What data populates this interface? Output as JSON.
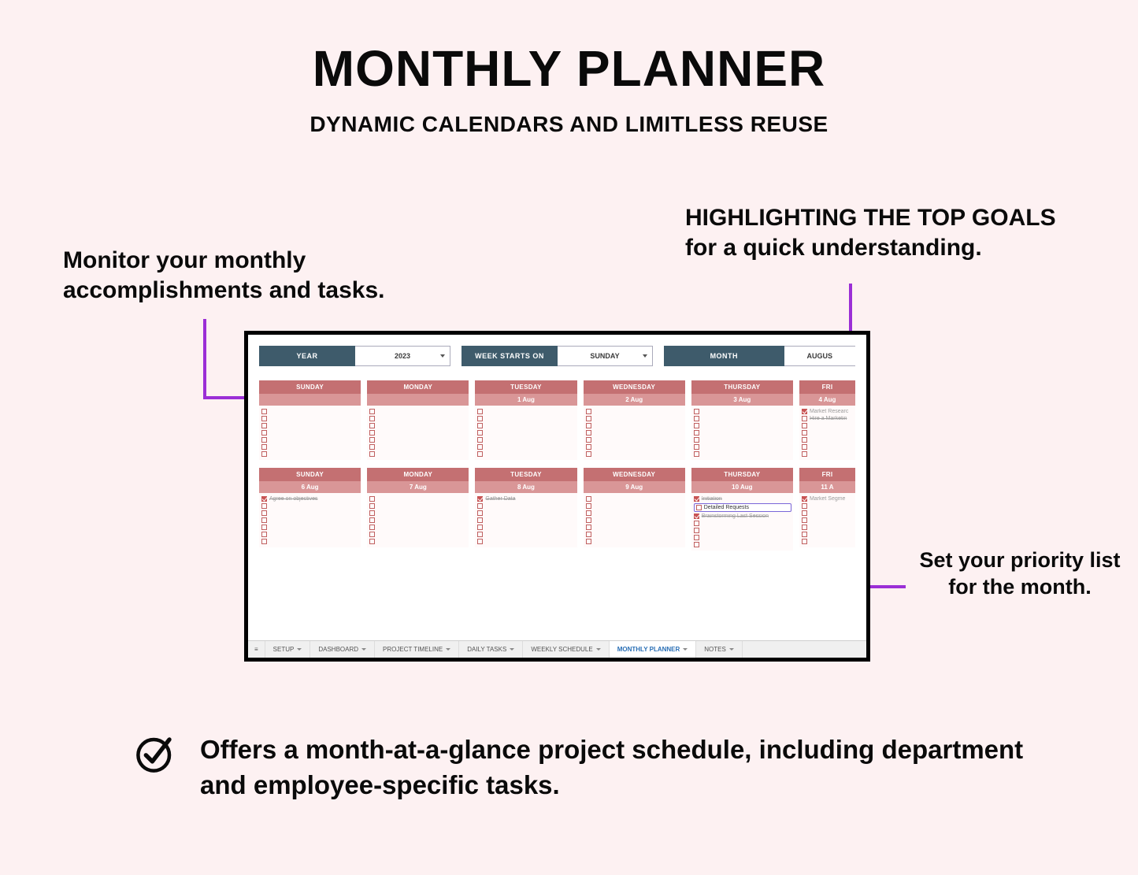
{
  "title": "MONTHLY PLANNER",
  "subtitle": "DYNAMIC CALENDARS AND LIMITLESS REUSE",
  "callouts": {
    "left_top": "Monitor your monthly accomplishments and tasks.",
    "right_top_line1": "HIGHLIGHTING THE TOP GOALS",
    "right_top_line2": "for a quick understanding.",
    "right_mid_line1": "Set your priority list",
    "right_mid_line2": "for the month."
  },
  "selectors": {
    "year_label": "YEAR",
    "year_value": "2023",
    "week_label": "WEEK STARTS ON",
    "week_value": "SUNDAY",
    "month_label": "MONTH",
    "month_value": "AUGUS"
  },
  "days": [
    "SUNDAY",
    "MONDAY",
    "TUESDAY",
    "WEDNESDAY",
    "THURSDAY",
    "FRI"
  ],
  "week1_dates": [
    "",
    "",
    "1 Aug",
    "2 Aug",
    "3 Aug",
    "4 Aug"
  ],
  "week2_dates": [
    "6 Aug",
    "7 Aug",
    "8 Aug",
    "9 Aug",
    "10 Aug",
    "11 A"
  ],
  "week1_tasks": {
    "5": [
      {
        "text": "Market Researc",
        "done": true
      },
      {
        "text": "Hire a Marketin",
        "done": false,
        "strike": true
      }
    ]
  },
  "week2_tasks": {
    "0": [
      {
        "text": "Agree on objectives",
        "done": true,
        "strike": true
      }
    ],
    "2": [
      {
        "text": "Gather Data",
        "done": true,
        "strike": true
      }
    ],
    "4": [
      {
        "text": "Initiation",
        "done": true,
        "strike": true
      },
      {
        "text": "Detailed Requests",
        "done": false,
        "hl": true
      },
      {
        "text": "Brainstorming Last Session",
        "done": true,
        "strike": true
      }
    ],
    "5": [
      {
        "text": "Market Segme",
        "done": true
      }
    ]
  },
  "empty_rows": 7,
  "tabs": [
    "SETUP",
    "DASHBOARD",
    "PROJECT TIMELINE",
    "DAILY TASKS",
    "WEEKLY SCHEDULE",
    "MONTHLY PLANNER",
    "NOTES"
  ],
  "active_tab": "MONTHLY PLANNER",
  "feature_text": "Offers a month-at-a-glance project schedule, including department and employee-specific tasks.",
  "colors": {
    "accent_purple": "#9b2fd6",
    "header_blue": "#3e5b6b",
    "day_red": "#c47072"
  }
}
